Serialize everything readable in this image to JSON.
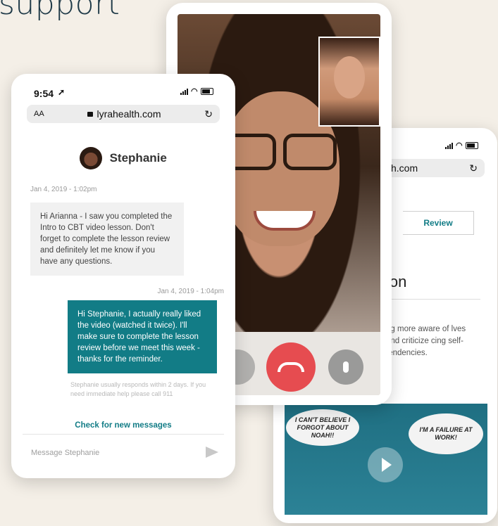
{
  "headline": "support",
  "chat_phone": {
    "time": "9:54",
    "url": "lyrahealth.com",
    "url_text_size": "AA",
    "contact_name": "Stephanie",
    "incoming": {
      "date": "Jan 4, 2019 - 1:02pm",
      "text": "Hi Arianna - I saw you completed the Intro to CBT video lesson. Don't forget to complete the lesson review and definitely let me know if you have any questions."
    },
    "outgoing": {
      "date": "Jan 4, 2019 - 1:04pm",
      "text": "Hi Stephanie, I actually really liked the video (watched it twice). I'll make sure to complete the lesson review before we meet this week - thanks for the reminder."
    },
    "response_note": "Stephanie usually responds within 2 days. If you need immediate help please call 911",
    "check_messages": "Check for new messages",
    "compose_placeholder": "Message Stephanie"
  },
  "right_phone": {
    "url_partial": "lth.com",
    "tab_review": "Review",
    "section_title_partial": "ion",
    "body_text_partial": "ng more aware of lves and criticize cing self- tendencies.",
    "comic_left_thought": "I CAN'T BELIEVE I FORGOT ABOUT NOAH!!",
    "comic_right_thought": "I'M A FAILURE AT WORK!"
  },
  "colors": {
    "accent": "#127c86",
    "end_call": "#e64c50",
    "background": "#f4efe7"
  }
}
